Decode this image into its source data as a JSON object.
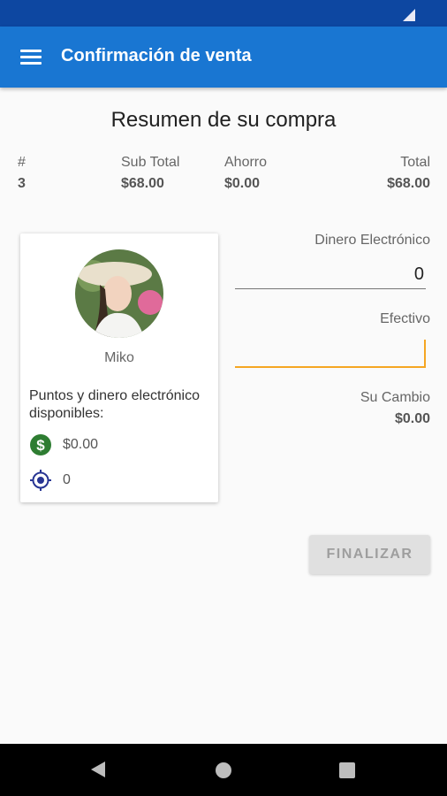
{
  "app_bar": {
    "title": "Confirmación de venta",
    "menu_icon": "hamburger-menu-icon"
  },
  "summary": {
    "title": "Resumen de su compra",
    "columns": [
      {
        "header": "#",
        "value": "3"
      },
      {
        "header": "Sub Total",
        "value": "$68.00"
      },
      {
        "header": "Ahorro",
        "value": "$0.00"
      },
      {
        "header": "Total",
        "value": "$68.00"
      }
    ]
  },
  "customer": {
    "name": "Miko",
    "points_label": "Puntos y dinero electrónico disponibles:",
    "money": "$0.00",
    "points": "0",
    "money_icon": "dollar-circle-icon",
    "points_icon": "target-icon"
  },
  "payment": {
    "dinero_label": "Dinero Electrónico",
    "dinero_value": "0",
    "efectivo_label": "Efectivo",
    "efectivo_value": "",
    "change_label": "Su Cambio",
    "change_value": "$0.00"
  },
  "finish_button": "FINALIZAR",
  "colors": {
    "primary": "#1976d2",
    "status_bar": "#0d47a1",
    "accent": "#f5a623",
    "money_icon": "#2e7d32",
    "points_icon": "#283593"
  }
}
